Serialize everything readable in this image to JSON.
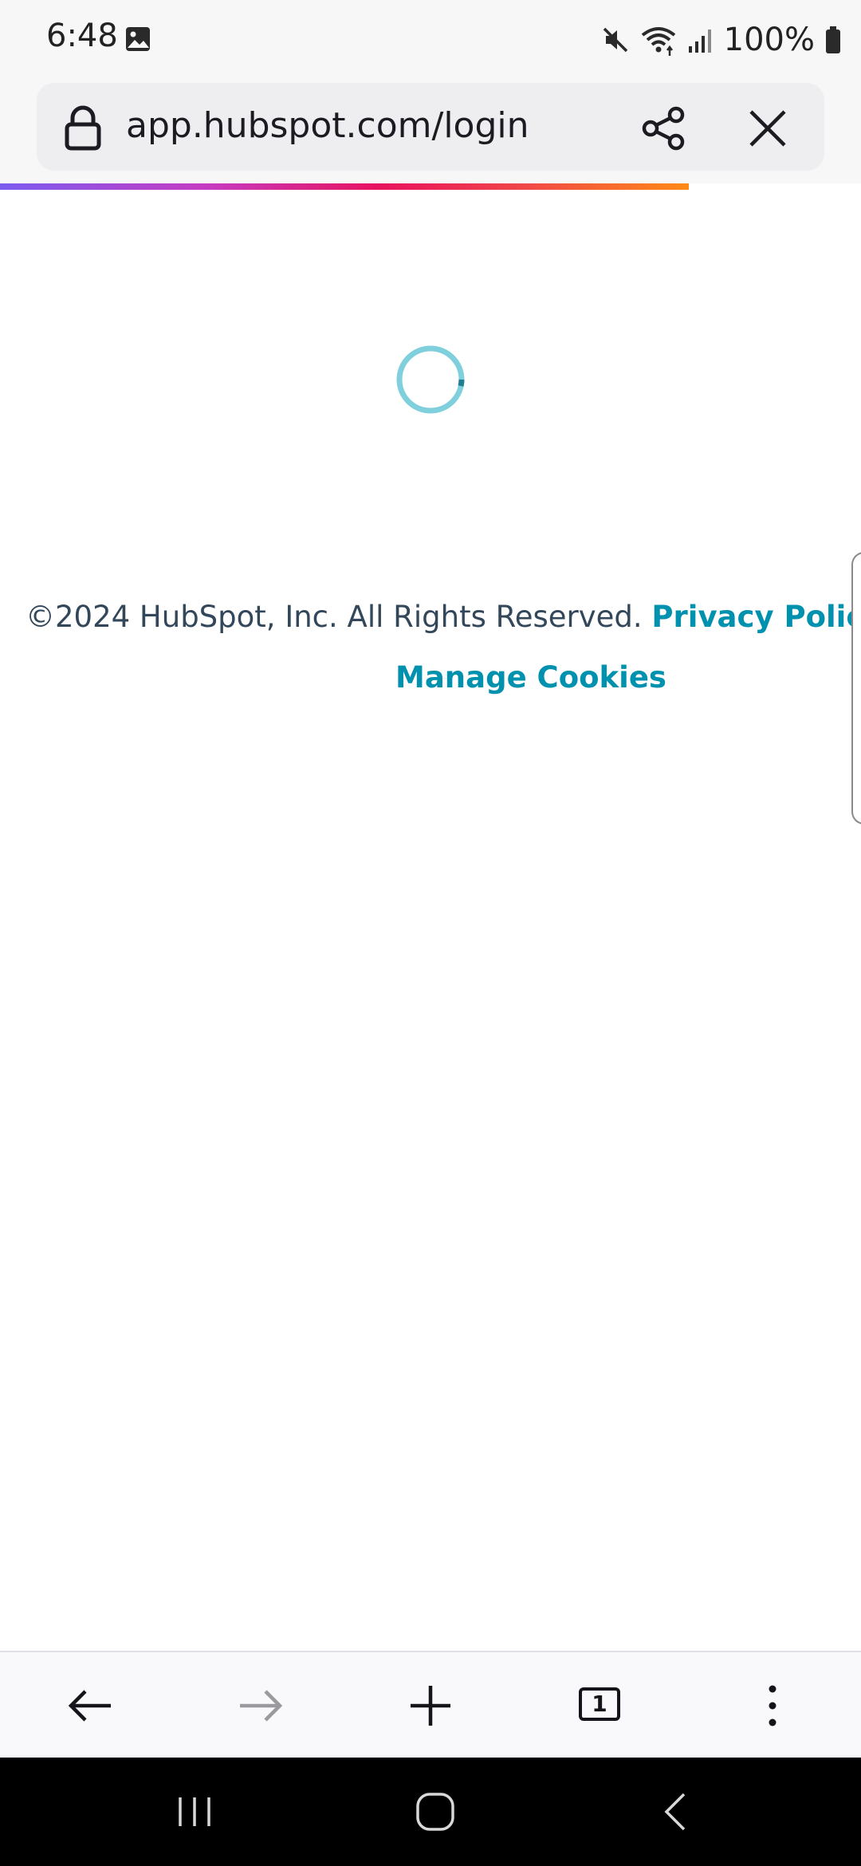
{
  "status_bar": {
    "time": "6:48",
    "battery": "100%",
    "icons": [
      "gallery-icon",
      "mute-icon",
      "wifi-icon",
      "signal-icon",
      "battery-icon"
    ]
  },
  "url_bar": {
    "url": "app.hubspot.com/login",
    "lock_icon": "lock-icon",
    "share_icon": "share-icon",
    "close_icon": "close-icon"
  },
  "page_load_progress": 0.8,
  "page": {
    "copyright": "©2024 HubSpot, Inc. All Rights Reserved.",
    "privacy_link": "Privacy Policy",
    "cookies_link": "Manage Cookies",
    "spinner": "loading-spinner"
  },
  "bottom_nav": {
    "back_icon": "back-arrow-icon",
    "forward_icon": "forward-arrow-icon",
    "new_tab_icon": "plus-icon",
    "tab_count": "1",
    "menu_icon": "more-vertical-icon"
  },
  "system_nav": {
    "recents_icon": "recents-icon",
    "home_icon": "home-icon",
    "back_icon": "back-chevron-icon"
  },
  "colors": {
    "link": "#0091ae",
    "text": "#33475b",
    "spinner": "#7fd0dc",
    "progress_gradient": [
      "#7b5cf0",
      "#e8125f",
      "#ff8a16"
    ]
  }
}
